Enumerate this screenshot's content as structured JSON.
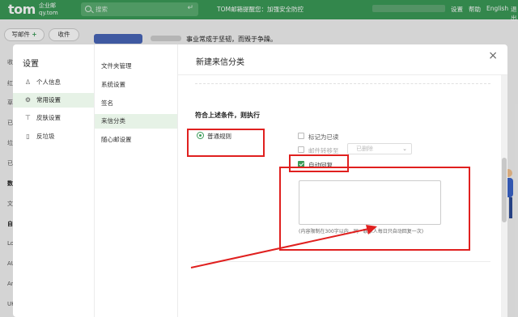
{
  "topbar": {
    "logo": "tom",
    "logo_sub_1": "企业邮",
    "logo_sub_2": "qy.tom",
    "search_placeholder": "搜索",
    "notice": "TOM邮箱提醒您：加强安全防控",
    "nav": [
      "设置",
      "帮助",
      "English",
      "退出"
    ]
  },
  "background": {
    "compose_label": "写邮件",
    "receive_label": "收件",
    "preview_text": "事业常成于坚韧，而毁于争躁。",
    "left_nav": [
      "收",
      "红",
      "草",
      "已",
      "垃",
      "已",
      "数",
      "文",
      "自",
      "Lo",
      "AU",
      "An",
      "UK"
    ]
  },
  "dialog": {
    "settings_title": "设置",
    "nav_primary": [
      {
        "icon": "user-icon",
        "label": "个人信息"
      },
      {
        "icon": "gear-icon",
        "label": "常用设置",
        "active": true
      },
      {
        "icon": "shirt-icon",
        "label": "皮肤设置"
      },
      {
        "icon": "trash-icon",
        "label": "反垃圾"
      }
    ],
    "nav_secondary": [
      {
        "label": "文件夹管理"
      },
      {
        "label": "系统设置"
      },
      {
        "label": "签名"
      },
      {
        "label": "来信分类",
        "active": true
      },
      {
        "label": "随心邮设置"
      }
    ],
    "title": "新建来信分类",
    "close_glyph": "×",
    "condition_title": "符合上述条件，则执行",
    "radio_label": "普通规则",
    "options": [
      {
        "label": "标记为已读",
        "checked": false
      },
      {
        "label": "邮件转移至",
        "checked": false,
        "dim": true
      },
      {
        "label": "自动回复",
        "checked": true
      }
    ],
    "select_value": "已删除",
    "textarea_value": "",
    "hint": "(内容限制在300字以内，同一联系人每日只自动回复一次)"
  },
  "colors": {
    "brand_green": "#3b9a57",
    "annotation_red": "#e0201f"
  }
}
